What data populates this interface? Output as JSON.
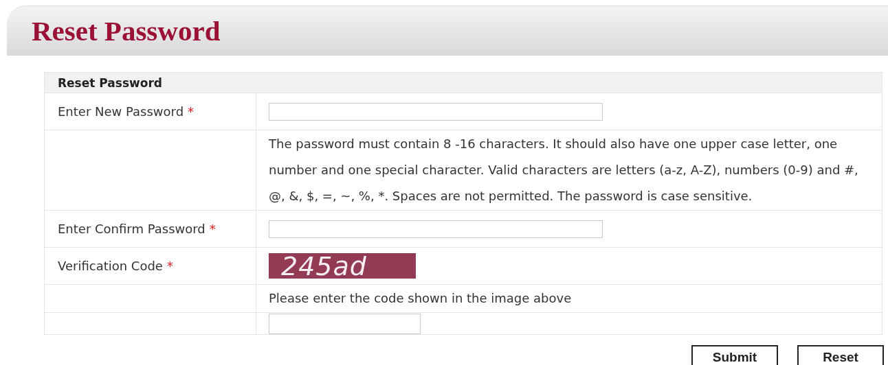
{
  "page_title": "Reset Password",
  "form": {
    "heading": "Reset Password",
    "required_mark": "*",
    "rows": [
      {
        "kind": "input",
        "label": "Enter New Password",
        "required": true
      },
      {
        "kind": "text",
        "text": "The password must contain 8 -16 characters. It should also have one upper case letter, one number and one special character. Valid characters are letters (a-z, A-Z), numbers (0-9) and #, @, &, $, =, ~, %, *. Spaces are not permitted. The password is case sensitive."
      },
      {
        "kind": "input",
        "label": "Enter Confirm Password",
        "required": true
      },
      {
        "kind": "captcha",
        "label": "Verification Code",
        "required": true,
        "code": "245ad"
      },
      {
        "kind": "text",
        "text": "Please enter the code shown in the image above"
      },
      {
        "kind": "code_input"
      }
    ]
  },
  "buttons": [
    "Submit",
    "Reset"
  ]
}
